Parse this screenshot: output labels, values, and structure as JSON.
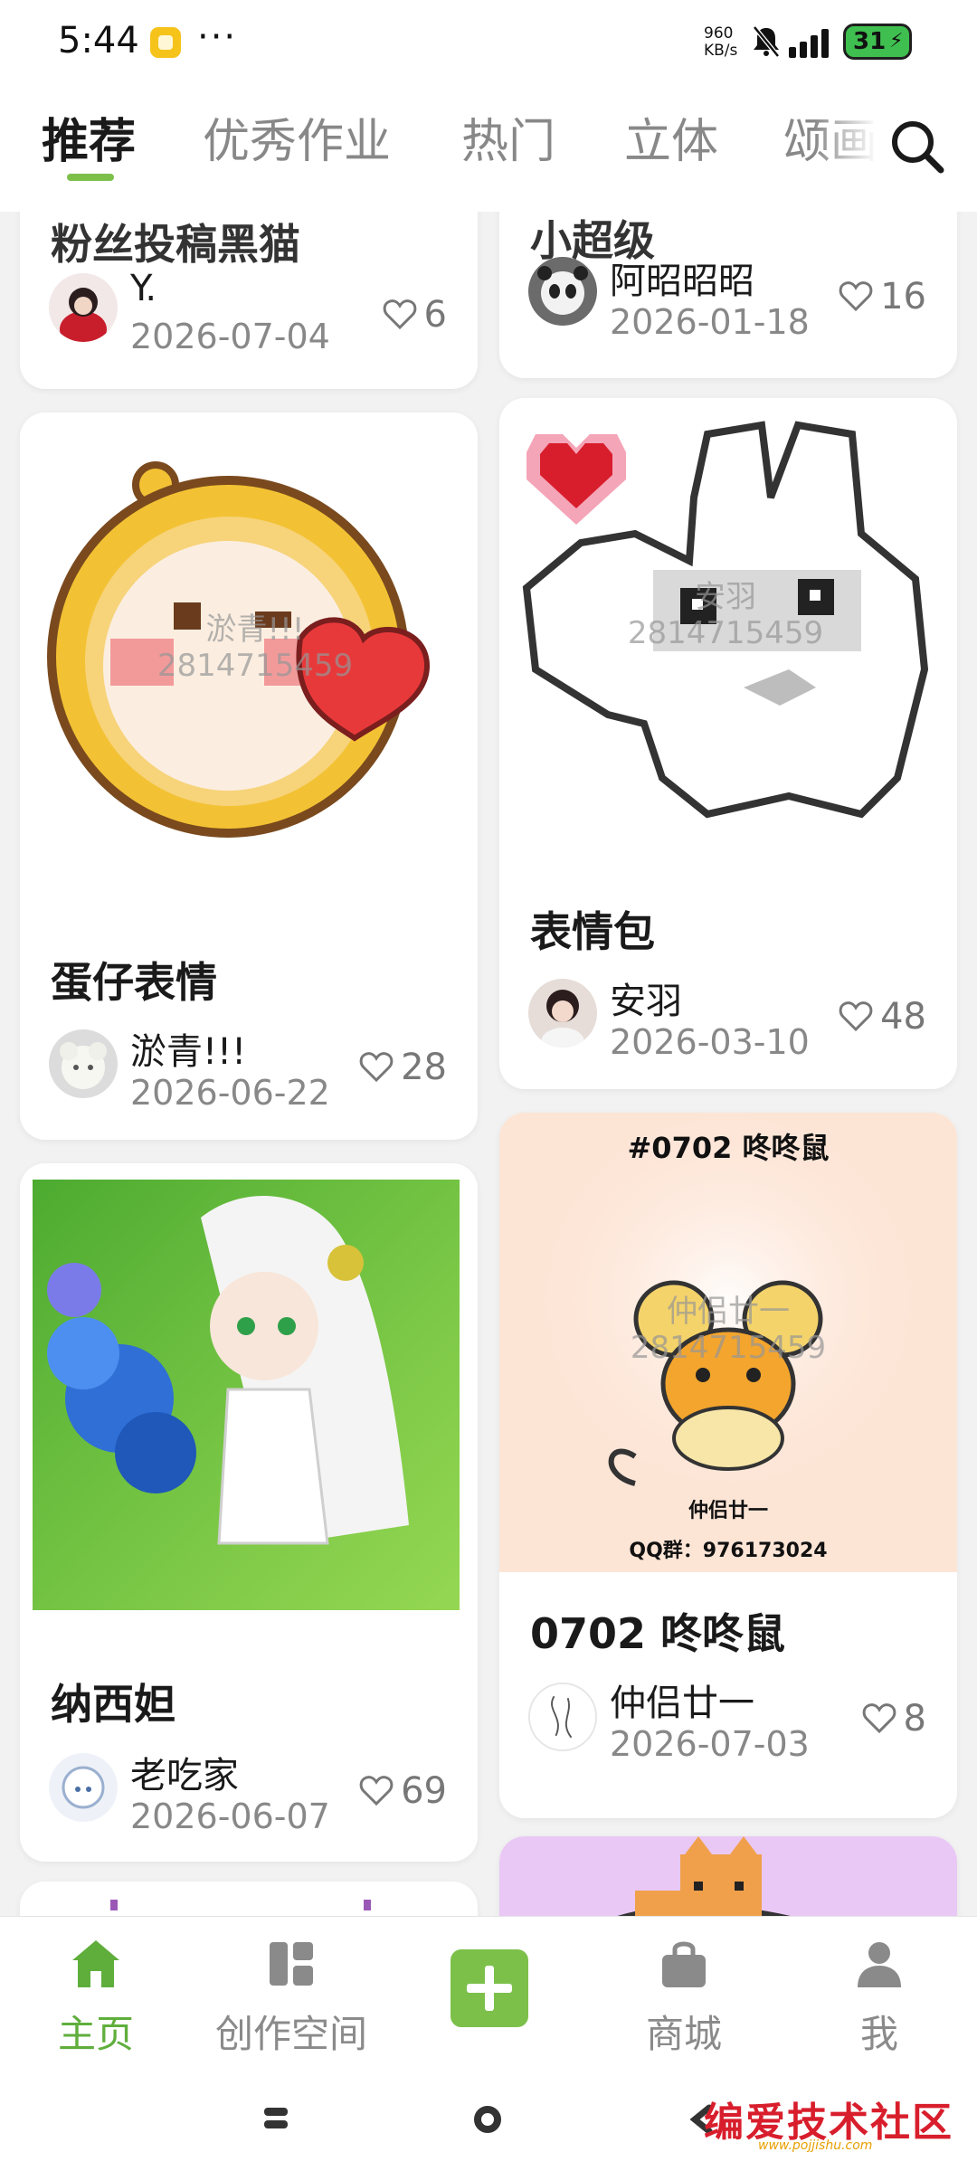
{
  "status_bar": {
    "time": "5:44",
    "dots": "···",
    "net_speed_value": "960",
    "net_speed_unit": "KB/s",
    "battery": "31"
  },
  "tabs": [
    "推荐",
    "优秀作业",
    "热门",
    "立体",
    "颂画"
  ],
  "cards": [
    {
      "title": "粉丝投稿黑猫",
      "author": "Y.",
      "date": "2026-07-04",
      "likes": "6"
    },
    {
      "title": "小超级",
      "author": "阿昭昭昭",
      "date": "2026-01-18",
      "likes": "16"
    },
    {
      "title": "蛋仔表情",
      "author": "淤青!!!",
      "date": "2026-06-22",
      "likes": "28",
      "watermark_1": "淤青!!!",
      "watermark_2": "2814715459"
    },
    {
      "title": "表情包",
      "author": "安羽",
      "date": "2026-03-10",
      "likes": "48",
      "watermark_1": "安羽",
      "watermark_2": "2814715459"
    },
    {
      "title": "纳西妲",
      "author": "老吃家",
      "date": "2026-06-07",
      "likes": "69"
    },
    {
      "title": "0702 咚咚鼠",
      "author": "仲侣廿一",
      "date": "2026-07-03",
      "likes": "8",
      "art_heading": "#0702 咚咚鼠",
      "art_signature": "仲侣廿一",
      "art_qq": "QQ群：976173024",
      "watermark_1": "仲侣廿一",
      "watermark_2": "2814715459"
    }
  ],
  "bottom_nav": {
    "home": "主页",
    "workspace": "创作空间",
    "shop": "商城",
    "me": "我"
  },
  "forum_logo": {
    "text": "编爱技术社区",
    "url": "www.pojjishu.com"
  },
  "colors": {
    "accent_green": "#7cc04a",
    "active_nav_green": "#5fae3c",
    "background": "#f2f2f2"
  },
  "icons": [
    "search-icon",
    "heart-icon",
    "home-icon",
    "grid-icon",
    "plus-icon",
    "shopping-bag-icon",
    "person-icon",
    "bell-muted-icon",
    "signal-icon",
    "battery-icon"
  ]
}
